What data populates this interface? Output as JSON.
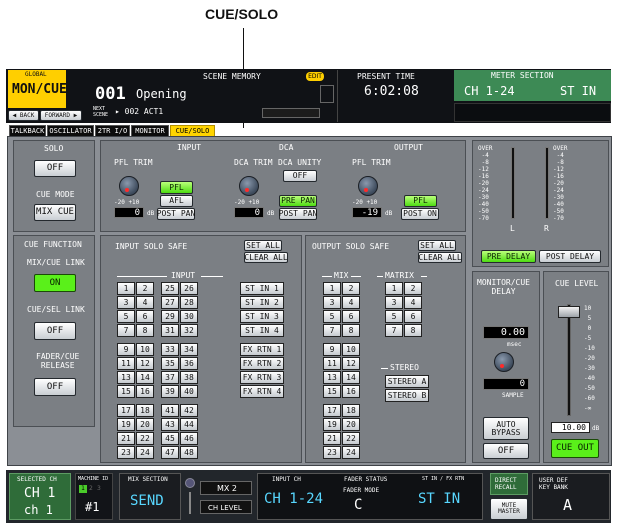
{
  "callout": {
    "label": "CUE/SOLO"
  },
  "header": {
    "global_label": "GLOBAL",
    "mode": "MON/CUE",
    "back": "◀ BACK",
    "forward": "FORWARD ▶",
    "scene_label": "SCENE MEMORY",
    "edit": "EDIT",
    "scene_num": "001",
    "scene_name": "Opening",
    "next_label": "NEXT\nSCENE",
    "next_scene": "▸ 002 ACT1",
    "time_label": "PRESENT TIME",
    "time": "6:02:08",
    "meter_label": "METER SECTION",
    "meter_ch": "CH 1-24",
    "meter_st": "ST IN"
  },
  "tabs": [
    "TALKBACK",
    "OSCILLATOR",
    "2TR I/O",
    "MONITOR",
    "CUE/SOLO"
  ],
  "solo": {
    "title": "SOLO",
    "value": "OFF"
  },
  "cue_mode": {
    "title": "CUE MODE",
    "value": "MIX CUE"
  },
  "cue_function": {
    "title": "CUE FUNCTION",
    "mix_cue_link": "MIX/CUE LINK",
    "mix_cue_value": "ON",
    "cue_sel_link": "CUE/SEL LINK",
    "cue_sel_value": "OFF",
    "fader_cue_release": "FADER/CUE\nRELEASE",
    "fader_cue_value": "OFF"
  },
  "input": {
    "title": "INPUT",
    "pfl_trim": "PFL TRIM",
    "range": "-20 +10",
    "value": "0",
    "unit": "dB",
    "pfl": "PFL",
    "afl": "AFL",
    "post_pan": "POST PAN"
  },
  "dca": {
    "title": "DCA",
    "dca_trim": "DCA TRIM",
    "dca_unity": "DCA UNITY",
    "unity_value": "OFF",
    "range": "-20 +10",
    "value": "0",
    "unit": "dB",
    "pre_pan": "PRE PAN",
    "post_pan": "POST PAN"
  },
  "output": {
    "title": "OUTPUT",
    "pfl_trim": "PFL TRIM",
    "range": "-20 +10",
    "value": "-19",
    "unit": "dB",
    "pfl": "PFL",
    "post_on": "POST ON"
  },
  "input_solo_safe": {
    "title": "INPUT SOLO SAFE",
    "set_all": "SET ALL",
    "clear_all": "CLEAR ALL",
    "input_header": "INPUT",
    "rows": [
      [
        "1",
        "2",
        "25",
        "26"
      ],
      [
        "3",
        "4",
        "27",
        "28"
      ],
      [
        "5",
        "6",
        "29",
        "30"
      ],
      [
        "7",
        "8",
        "31",
        "32"
      ],
      [
        "9",
        "10",
        "33",
        "34"
      ],
      [
        "11",
        "12",
        "35",
        "36"
      ],
      [
        "13",
        "14",
        "37",
        "38"
      ],
      [
        "15",
        "16",
        "39",
        "40"
      ],
      [
        "17",
        "18",
        "41",
        "42"
      ],
      [
        "19",
        "20",
        "43",
        "44"
      ],
      [
        "21",
        "22",
        "45",
        "46"
      ],
      [
        "23",
        "24",
        "47",
        "48"
      ]
    ],
    "st_in": [
      "ST IN 1",
      "ST IN 2",
      "ST IN 3",
      "ST IN 4"
    ],
    "fx_rtn": [
      "FX RTN 1",
      "FX RTN 2",
      "FX RTN 3",
      "FX RTN 4"
    ]
  },
  "output_solo_safe": {
    "title": "OUTPUT SOLO SAFE",
    "set_all": "SET ALL",
    "clear_all": "CLEAR ALL",
    "mix_header": "MIX",
    "matrix_header": "MATRIX",
    "stereo_header": "STEREO",
    "mix_rows": [
      [
        "1",
        "2"
      ],
      [
        "3",
        "4"
      ],
      [
        "5",
        "6"
      ],
      [
        "7",
        "8"
      ],
      [
        "9",
        "10"
      ],
      [
        "11",
        "12"
      ],
      [
        "13",
        "14"
      ],
      [
        "15",
        "16"
      ],
      [
        "17",
        "18"
      ],
      [
        "19",
        "20"
      ],
      [
        "21",
        "22"
      ],
      [
        "23",
        "24"
      ]
    ],
    "matrix_rows": [
      [
        "1",
        "2"
      ],
      [
        "3",
        "4"
      ],
      [
        "5",
        "6"
      ],
      [
        "7",
        "8"
      ]
    ],
    "stereo": [
      "STEREO A",
      "STEREO B"
    ]
  },
  "meters": {
    "scale": "OVER\n -4\n -8\n-12\n-16\n-20\n-24\n-30\n-40\n-50\n-70",
    "l": "L",
    "r": "R",
    "pre_delay": "PRE DELAY",
    "post_delay": "POST DELAY"
  },
  "monitor_delay": {
    "title": "MONITOR/CUE\nDELAY",
    "msec_value": "0.00",
    "msec_unit": "msec",
    "sample_value": "0",
    "sample_unit": "SAMPLE",
    "auto_bypass": "AUTO\nBYPASS",
    "bypass_value": "OFF"
  },
  "cue_level": {
    "title": "CUE LEVEL",
    "scale": "10\n 5\n 0\n-5\n-10\n-20\n-30\n-40\n-50\n-60\n-∞",
    "value": "10.00",
    "unit": "dB",
    "cue_out": "CUE OUT"
  },
  "footer": {
    "selected_ch_label": "SELECTED CH",
    "selected_ch": "CH 1",
    "selected_name": "ch 1",
    "machine_label": "MACHINE ID",
    "machine_digits": [
      "1",
      "2",
      "3"
    ],
    "machine_value": "#1",
    "mix_section_label": "MIX SECTION",
    "mix_section": "SEND",
    "mix_num": "MX 2",
    "ch_level": "CH LEVEL",
    "input_ch_label": "INPUT CH",
    "input_ch": "CH 1-24",
    "fader_status_label": "FADER STATUS",
    "fader_mode_label": "FADER MODE",
    "fader_mode": "C",
    "st_in_label": "ST IN / FX RTN",
    "st_in": "ST IN",
    "direct_recall": "DIRECT\nRECALL",
    "user_def_label": "USER DEF\nKEY BANK",
    "mute_master": "MUTE\nMASTER",
    "bank": "A"
  }
}
